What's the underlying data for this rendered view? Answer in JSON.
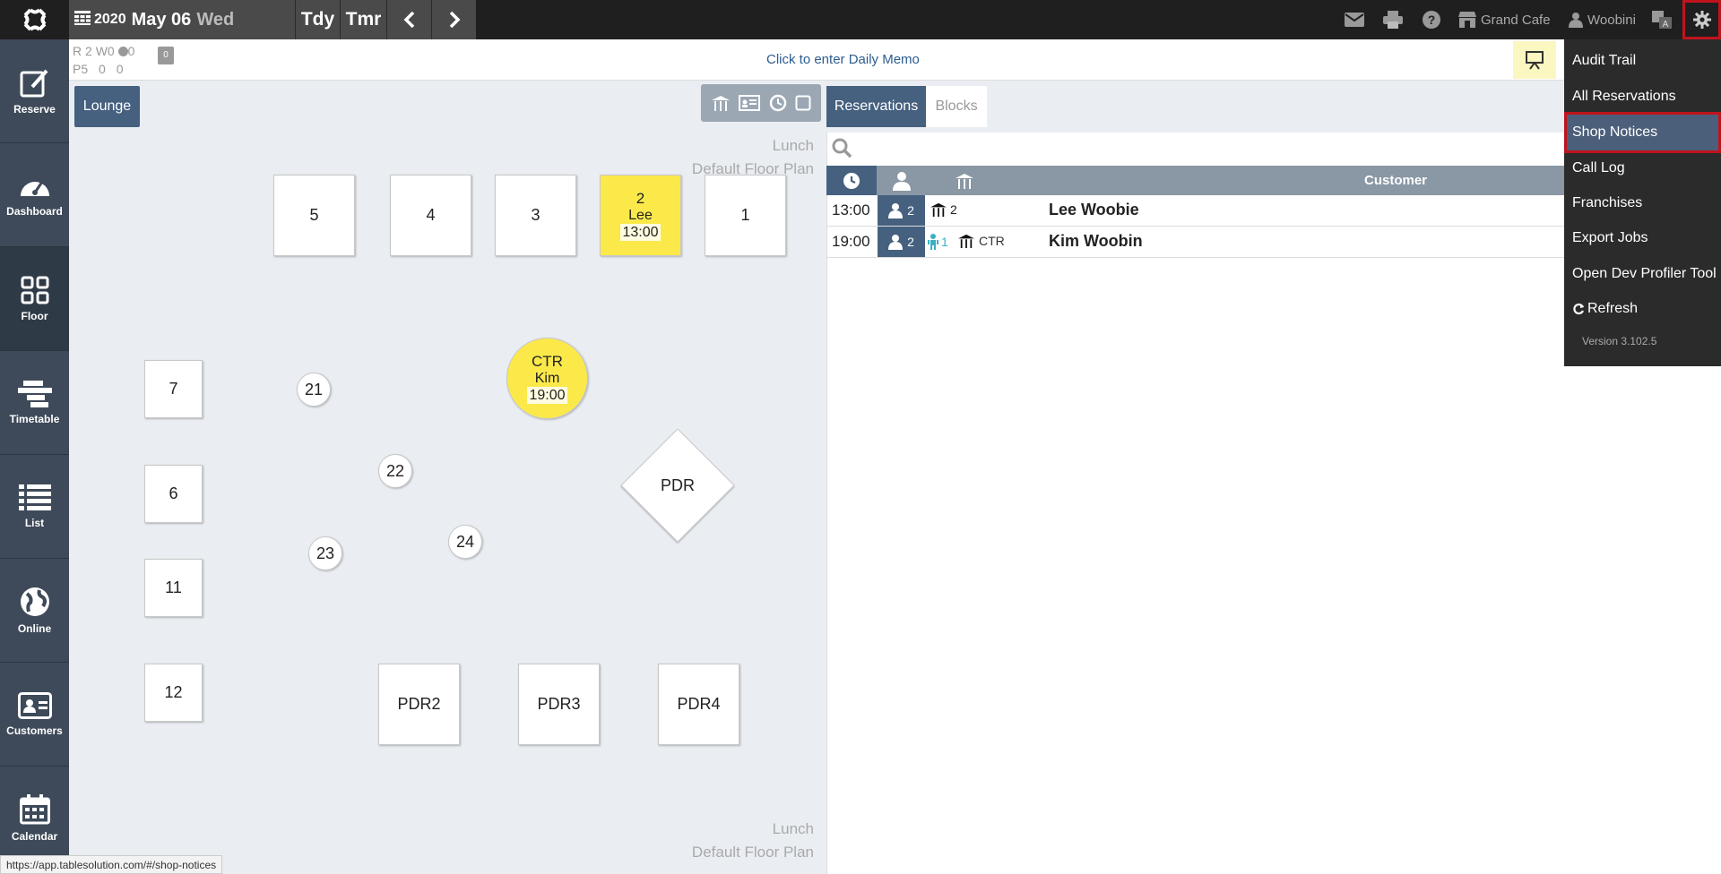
{
  "header": {
    "year": "2020",
    "month_day": "May 06",
    "weekday": "Wed",
    "today_label": "Tdy",
    "tomorrow_label": "Tmr",
    "shop_name": "Grand Cafe",
    "user_name": "Woobini"
  },
  "sidebar": {
    "items": [
      {
        "label": "Reserve",
        "icon": "reserve-icon"
      },
      {
        "label": "Dashboard",
        "icon": "dashboard-icon"
      },
      {
        "label": "Floor",
        "icon": "floor-icon"
      },
      {
        "label": "Timetable",
        "icon": "timetable-icon"
      },
      {
        "label": "List",
        "icon": "list-icon"
      },
      {
        "label": "Online",
        "icon": "globe-icon"
      },
      {
        "label": "Customers",
        "icon": "customers-icon"
      },
      {
        "label": "Calendar",
        "icon": "calendar-icon"
      }
    ]
  },
  "stats": {
    "r_label": "R",
    "r_val": "2",
    "w_label": "W",
    "w_val": "0",
    "o_val": "0",
    "p_label": "P",
    "p_val": "5",
    "p_w": "0",
    "p_o": "0",
    "note_count": "0"
  },
  "memo": "Click to enter Daily Memo",
  "floor": {
    "area_tab": "Lounge",
    "service": "Lunch",
    "plan": "Default Floor Plan",
    "tables": {
      "t5": "5",
      "t4": "4",
      "t3": "3",
      "t1": "1",
      "t7": "7",
      "t6": "6",
      "t11": "11",
      "t12": "12",
      "t21": "21",
      "t22": "22",
      "t23": "23",
      "t24": "24",
      "pdr": "PDR",
      "pdr2": "PDR2",
      "pdr3": "PDR3",
      "pdr4": "PDR4"
    },
    "booked_t2": {
      "table": "2",
      "name": "Lee",
      "time": "13:00"
    },
    "booked_ctr": {
      "table": "CTR",
      "name": "Kim",
      "time": "19:00"
    }
  },
  "reservations": {
    "tabs": [
      "Reservations",
      "Blocks"
    ],
    "column_customer": "Customer",
    "rows": [
      {
        "time": "13:00",
        "pax": "2",
        "child": "",
        "table": "2",
        "customer": "Lee Woobie"
      },
      {
        "time": "19:00",
        "pax": "2",
        "child": "1",
        "table": "CTR",
        "customer": "Kim Woobin"
      }
    ]
  },
  "settings_menu": {
    "items": [
      "Audit Trail",
      "All Reservations",
      "Shop Notices",
      "Call Log",
      "Franchises",
      "Export Jobs",
      "Open Dev Profiler Tool",
      "Refresh"
    ],
    "highlighted": "Shop Notices",
    "version": "Version 3.102.5"
  },
  "status_url": "https://app.tablesolution.com/#/shop-notices",
  "colors": {
    "topbar": "#1f1f1f",
    "sidebar": "#3e4a59",
    "accent": "#46607f",
    "booked": "#fbe94a",
    "highlight_border": "#c0131c"
  }
}
